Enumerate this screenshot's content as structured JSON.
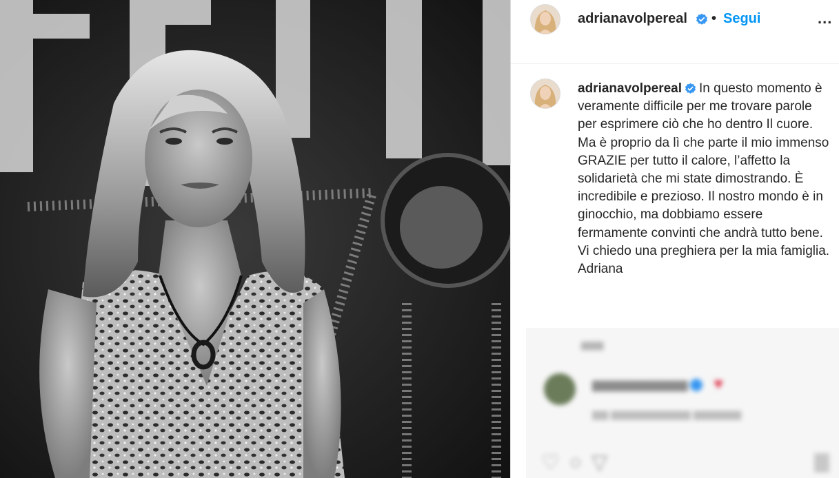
{
  "post": {
    "author": {
      "username": "adrianavolpereal",
      "verified": true
    },
    "header": {
      "separator": "•",
      "follow_label": "Segui",
      "more_label": "..."
    },
    "caption": {
      "text": "In questo momento è veramente difficile per me trovare parole per esprimere ciò che ho dentro Il cuore. Ma è proprio da lì che parte il mio immenso GRAZIE per tutto il calore, l’affetto la solidarietà che mi state dimostrando. È incredibile e prezioso. Il nostro mondo è in ginocchio, ma dobbiamo essere fermamente convinti che andrà tutto bene. Vi chiedo una preghiera per la mia famiglia.\nAdriana"
    }
  },
  "colors": {
    "link": "#0095f6",
    "text": "#262626",
    "verified_badge": "#3897f0",
    "border": "#dbdbdb"
  },
  "icons": [
    "verified-badge-icon",
    "more-options-icon",
    "heart-icon",
    "comment-icon",
    "share-icon",
    "bookmark-icon"
  ]
}
